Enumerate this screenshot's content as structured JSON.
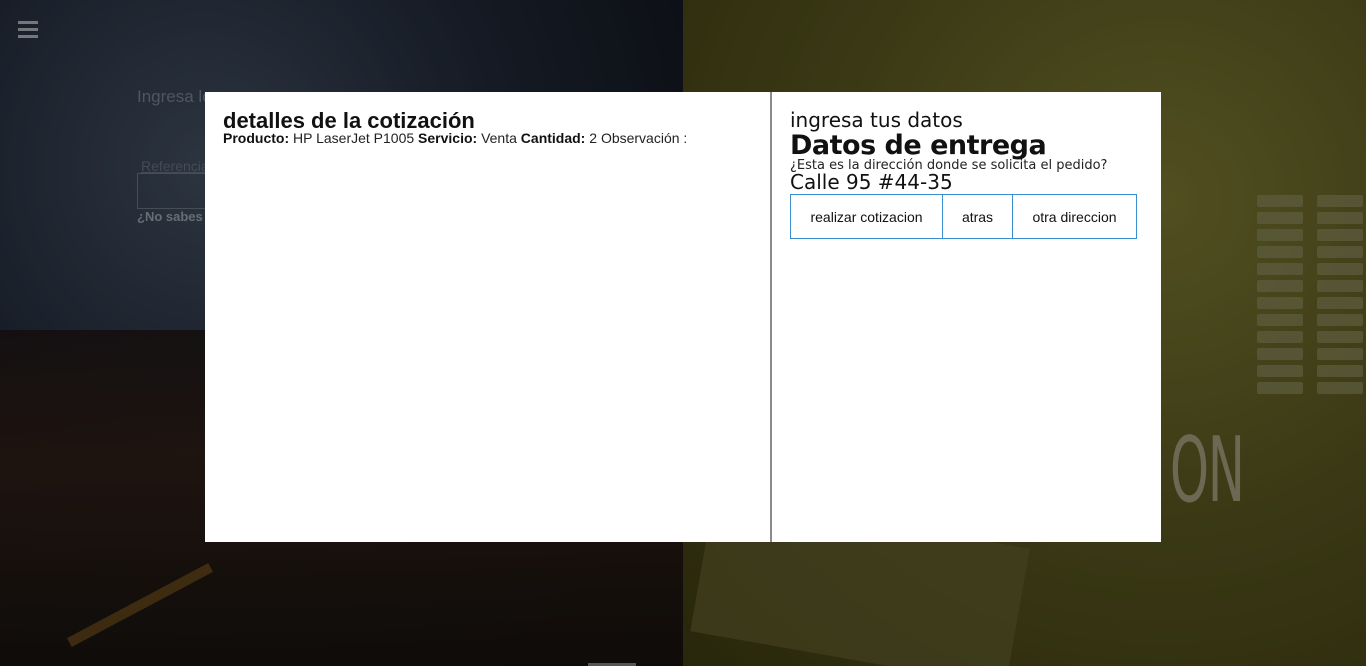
{
  "background": {
    "prompt_text": "Ingresa los datos del Producto y/o Servicio que desea cotizar",
    "reference_label": "Referencia",
    "help_text": "¿No sabes cuál es la referencia?",
    "big_text": "ON",
    "menu_icon": "hamburger-menu-icon"
  },
  "modal": {
    "left": {
      "title": "detalles de la cotización",
      "producto_label": "Producto:",
      "producto_value": "HP LaserJet P1005",
      "servicio_label": "Servicio:",
      "servicio_value": "Venta",
      "cantidad_label": "Cantidad:",
      "cantidad_value": "2",
      "observacion_label": "Observación :"
    },
    "right": {
      "subtitle": "ingresa tus datos",
      "title": "Datos de entrega",
      "question": "¿Esta es la dirección donde se solicita el pedido?",
      "address": "Calle 95 #44-35",
      "buttons": {
        "quote": "realizar cotizacion",
        "back": "atras",
        "other_address": "otra direccion"
      }
    }
  },
  "colors": {
    "button_border": "#3a8fd0",
    "divider": "#8a8a8a"
  }
}
